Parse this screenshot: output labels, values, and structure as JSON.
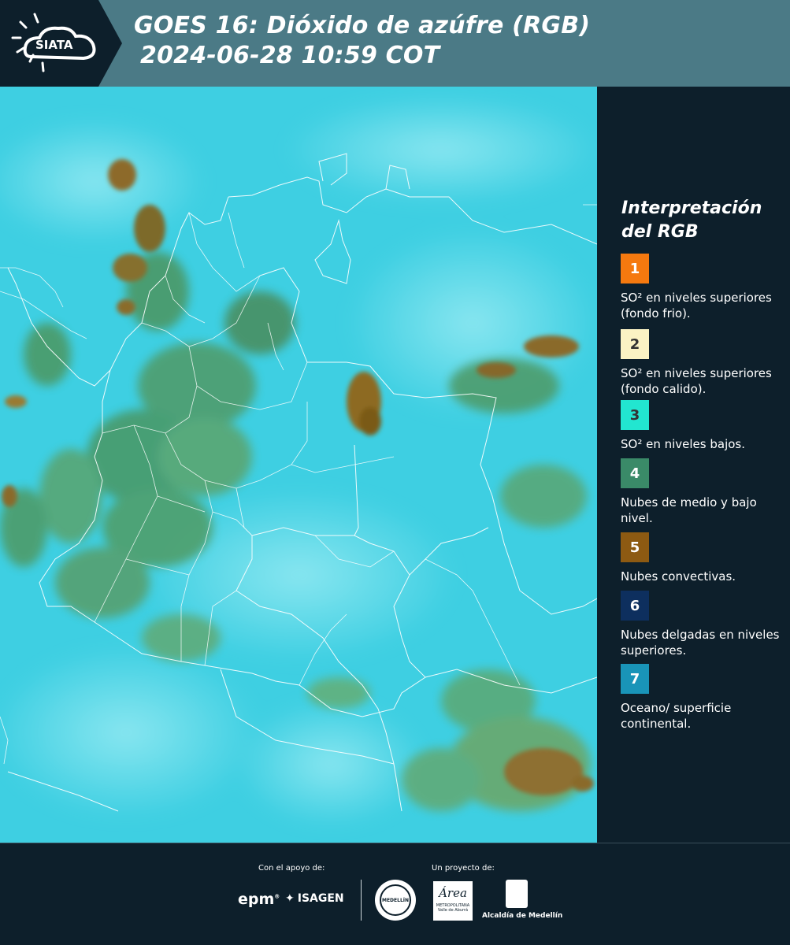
{
  "header": {
    "logo_text": "SIATA",
    "title_line1": "GOES 16: Dióxido de azúfre (RGB)",
    "title_line2": "2024-06-28 10:59 COT"
  },
  "legend": {
    "title_line1": "Interpretación",
    "title_line2": "del RGB",
    "items": [
      {
        "number": "1",
        "color": "#f5790f",
        "text": "SO² en niveles superiores (fondo frio)."
      },
      {
        "number": "2",
        "color": "#fbf3c4",
        "text": "SO² en niveles superiores (fondo calido)."
      },
      {
        "number": "3",
        "color": "#22e6d0",
        "text": "SO² en niveles bajos."
      },
      {
        "number": "4",
        "color": "#3a8a68",
        "text": "Nubes de medio y bajo nivel."
      },
      {
        "number": "5",
        "color": "#8d5a12",
        "text": "Nubes convectivas."
      },
      {
        "number": "6",
        "color": "#0d2f5e",
        "text": "Nubes delgadas en niveles superiores."
      },
      {
        "number": "7",
        "color": "#1994b8",
        "text": "Oceano/ superficie continental."
      }
    ]
  },
  "footer": {
    "support_label": "Con el apoyo de:",
    "project_label": "Un proyecto de:",
    "logo_epm": "epm",
    "logo_isagen": "ISAGEN",
    "logo_area": "Área",
    "logo_area_sub": "METROPOLITANA",
    "logo_area_sub2": "Valle de Aburrá",
    "logo_seal": "MEDELLÍN",
    "logo_alcaldia": "Alcaldía de Medellín"
  },
  "colors": {
    "header_bg": "#4b7a86",
    "page_bg": "#0d1f2b",
    "map_cyan": "#3fd3e6",
    "map_green": "#4b9a6e",
    "map_brown": "#8d6a2a"
  }
}
